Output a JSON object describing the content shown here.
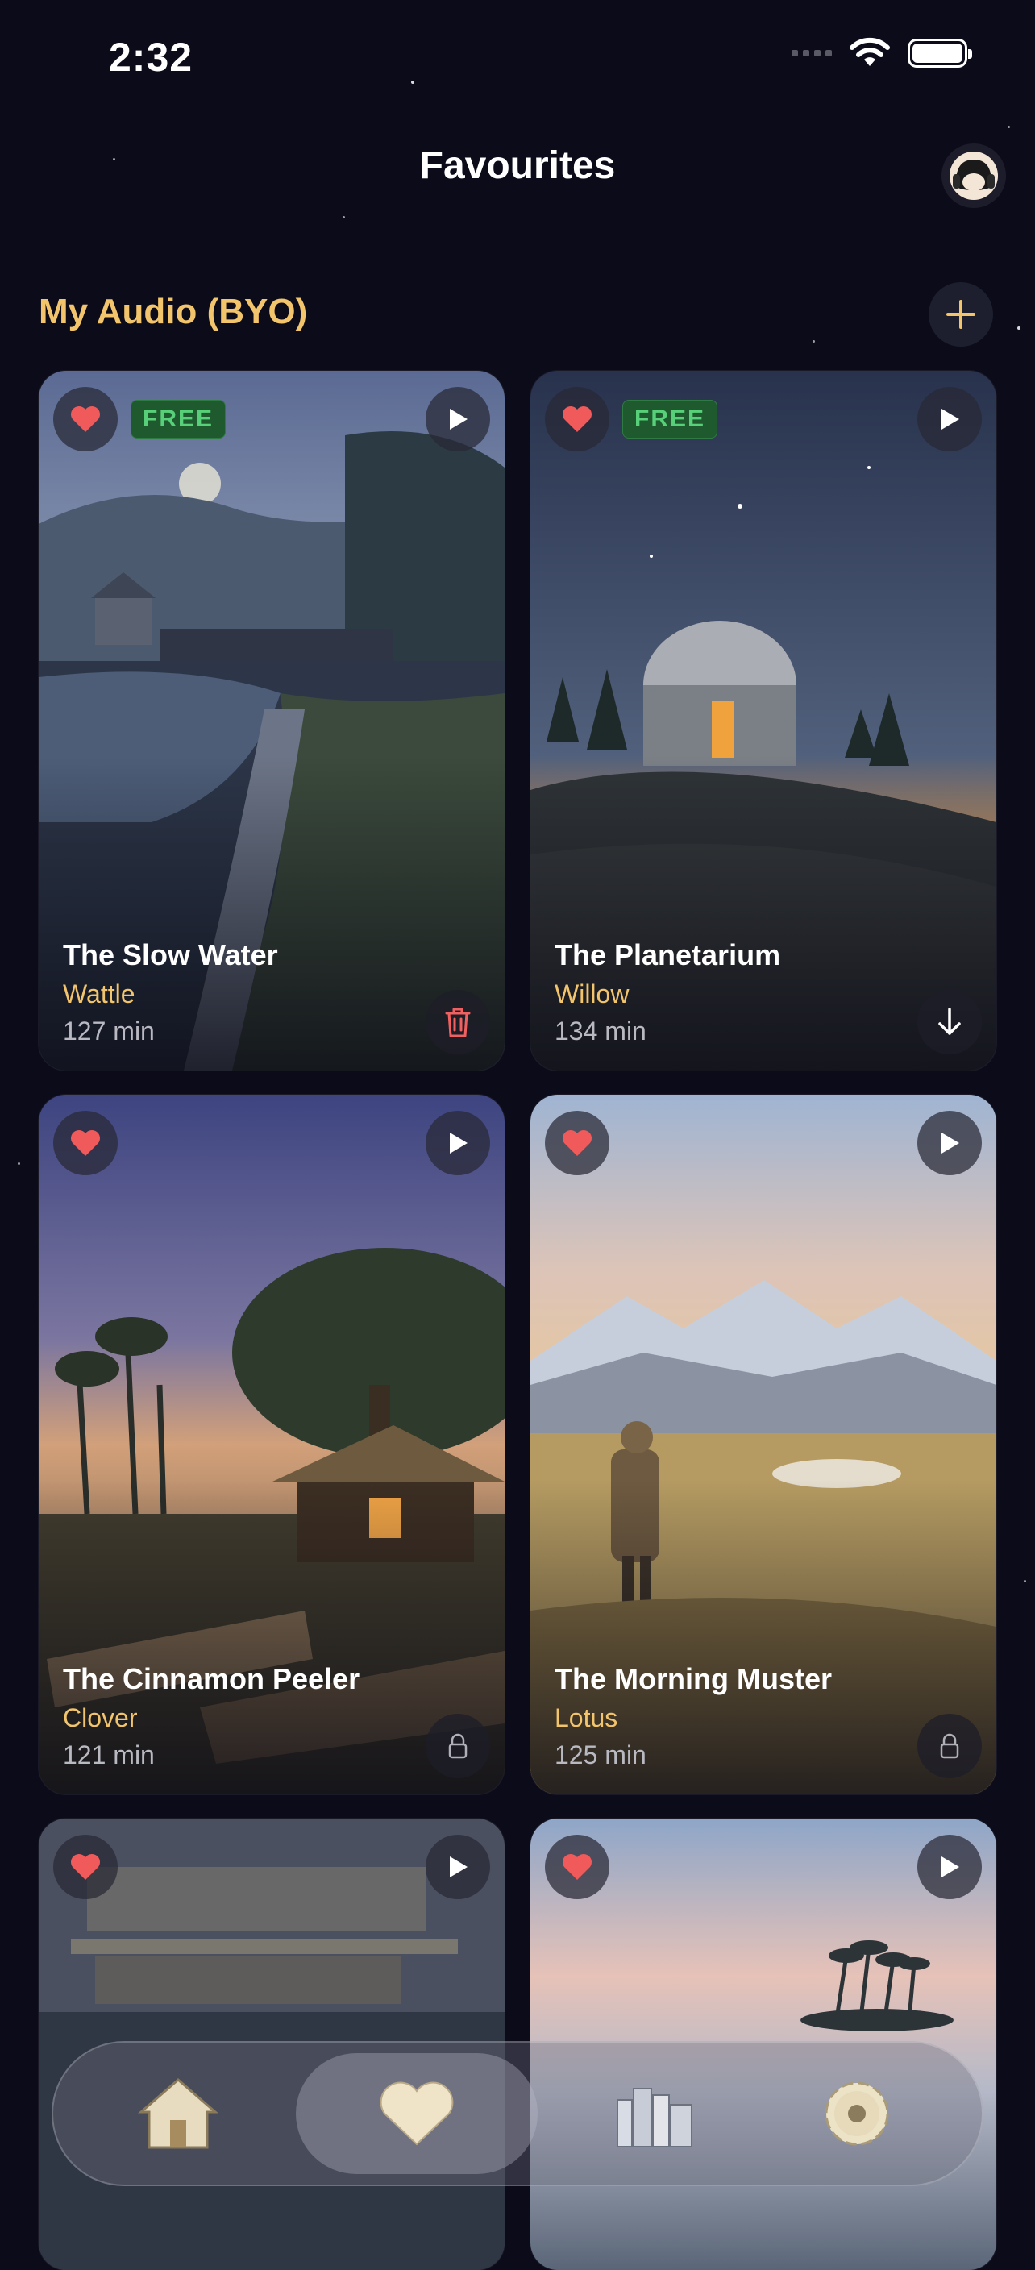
{
  "status_bar": {
    "time": "2:32"
  },
  "header": {
    "title": "Favourites",
    "profile_icon": "headphones-avatar-icon"
  },
  "section": {
    "title": "My Audio (BYO)",
    "add_icon": "plus-icon"
  },
  "cards": [
    {
      "title": "The Slow Water",
      "author": "Wattle",
      "duration": "127 min",
      "badge": "FREE",
      "corner_icon": "trash-icon"
    },
    {
      "title": "The Planetarium",
      "author": "Willow",
      "duration": "134 min",
      "badge": "FREE",
      "corner_icon": "download-icon"
    },
    {
      "title": "The Cinnamon Peeler",
      "author": "Clover",
      "duration": "121 min",
      "badge": "",
      "corner_icon": "lock-icon"
    },
    {
      "title": "The Morning Muster",
      "author": "Lotus",
      "duration": "125 min",
      "badge": "",
      "corner_icon": "lock-icon"
    },
    {
      "title": "",
      "author": "",
      "duration": "",
      "badge": "",
      "corner_icon": ""
    },
    {
      "title": "",
      "author": "",
      "duration": "",
      "badge": "",
      "corner_icon": ""
    }
  ],
  "tab_bar": {
    "tabs": [
      {
        "icon": "home-icon",
        "active": false
      },
      {
        "icon": "heart-icon",
        "active": true
      },
      {
        "icon": "library-icon",
        "active": false
      },
      {
        "icon": "settings-icon",
        "active": false
      }
    ]
  },
  "colors": {
    "accent": "#f2c46b",
    "heart": "#f05a5a",
    "free_badge": "#58d07a",
    "background": "#0b0b1a"
  }
}
